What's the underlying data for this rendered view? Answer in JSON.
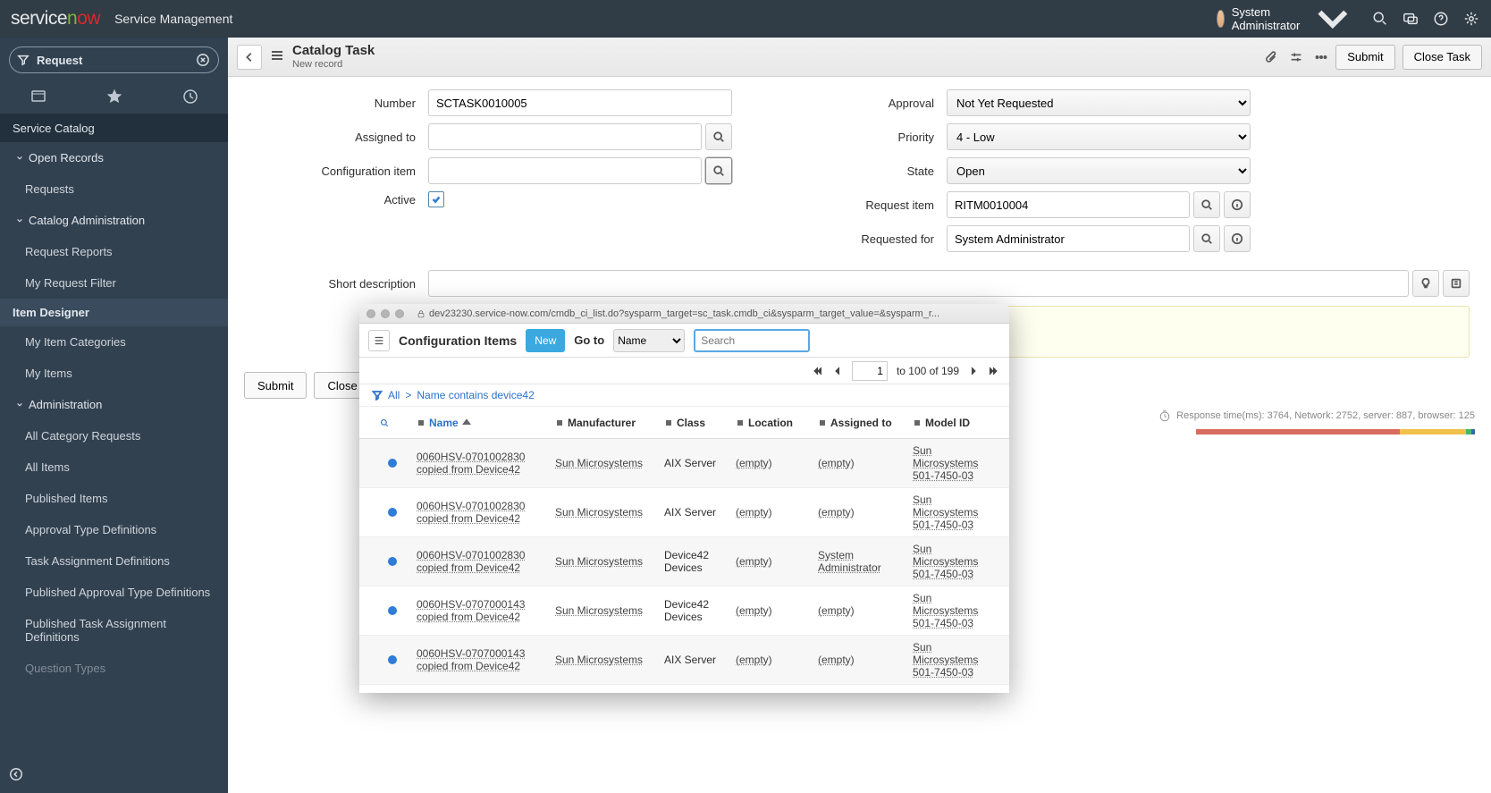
{
  "header": {
    "app_title": "Service Management",
    "user_name": "System Administrator"
  },
  "sidebar": {
    "filter_text": "Request",
    "sections": {
      "service_catalog": "Service Catalog",
      "open_records": "Open Records",
      "requests": "Requests",
      "catalog_admin": "Catalog Administration",
      "request_reports": "Request Reports",
      "my_request_filter": "My Request Filter",
      "item_designer": "Item Designer",
      "my_item_categories": "My Item Categories",
      "my_items": "My Items",
      "administration": "Administration",
      "all_category_requests": "All Category Requests",
      "all_items": "All Items",
      "published_items": "Published Items",
      "approval_type_defs": "Approval Type Definitions",
      "task_assignment_defs": "Task Assignment Definitions",
      "pub_approval_defs": "Published Approval Type Definitions",
      "pub_task_defs": "Published Task Assignment Definitions",
      "question_types": "Question Types"
    }
  },
  "toolbar": {
    "title": "Catalog Task",
    "subtitle": "New record",
    "submit": "Submit",
    "close_task": "Close Task"
  },
  "form": {
    "left": {
      "number_label": "Number",
      "number_value": "SCTASK0010005",
      "assigned_to_label": "Assigned to",
      "config_item_label": "Configuration item",
      "active_label": "Active"
    },
    "right": {
      "approval_label": "Approval",
      "approval_value": "Not Yet Requested",
      "priority_label": "Priority",
      "priority_value": "4 - Low",
      "state_label": "State",
      "state_value": "Open",
      "request_item_label": "Request item",
      "request_item_value": "RITM0010004",
      "requested_for_label": "Requested for",
      "requested_for_value": "System Administrator"
    },
    "short_desc_label": "Short description"
  },
  "actions": {
    "submit": "Submit",
    "close": "Close Task"
  },
  "resp": {
    "text": "Response time(ms): 3764, Network: 2752, server: 887, browser: 125"
  },
  "popup": {
    "url": "dev23230.service-now.com/cmdb_ci_list.do?sysparm_target=sc_task.cmdb_ci&sysparm_target_value=&sysparm_r...",
    "title": "Configuration Items",
    "new_btn": "New",
    "goto": "Go to",
    "goto_field": "Name",
    "search_placeholder": "Search",
    "page_current": "1",
    "page_text": "to 100 of 199",
    "filter_all": "All",
    "filter_cond": "Name contains device42",
    "columns": {
      "name": "Name",
      "mfr": "Manufacturer",
      "class": "Class",
      "loc": "Location",
      "assign": "Assigned to",
      "model": "Model ID"
    },
    "rows": [
      {
        "name": "0060HSV-0701002830 copied from Device42",
        "mfr": "Sun Microsystems",
        "class": "AIX Server",
        "loc": "(empty)",
        "assign": "(empty)",
        "model": "Sun Microsystems 501-7450-03"
      },
      {
        "name": "0060HSV-0701002830 copied from Device42",
        "mfr": "Sun Microsystems",
        "class": "AIX Server",
        "loc": "(empty)",
        "assign": "(empty)",
        "model": "Sun Microsystems 501-7450-03"
      },
      {
        "name": "0060HSV-0701002830 copied from Device42",
        "mfr": "Sun Microsystems",
        "class": "Device42 Devices",
        "loc": "(empty)",
        "assign": "System Administrator",
        "model": "Sun Microsystems 501-7450-03"
      },
      {
        "name": "0060HSV-0707000143 copied from Device42",
        "mfr": "Sun Microsystems",
        "class": "Device42 Devices",
        "loc": "(empty)",
        "assign": "(empty)",
        "model": "Sun Microsystems 501-7450-03"
      },
      {
        "name": "0060HSV-0707000143 copied from Device42",
        "mfr": "Sun Microsystems",
        "class": "AIX Server",
        "loc": "(empty)",
        "assign": "(empty)",
        "model": "Sun Microsystems 501-7450-03"
      }
    ]
  }
}
